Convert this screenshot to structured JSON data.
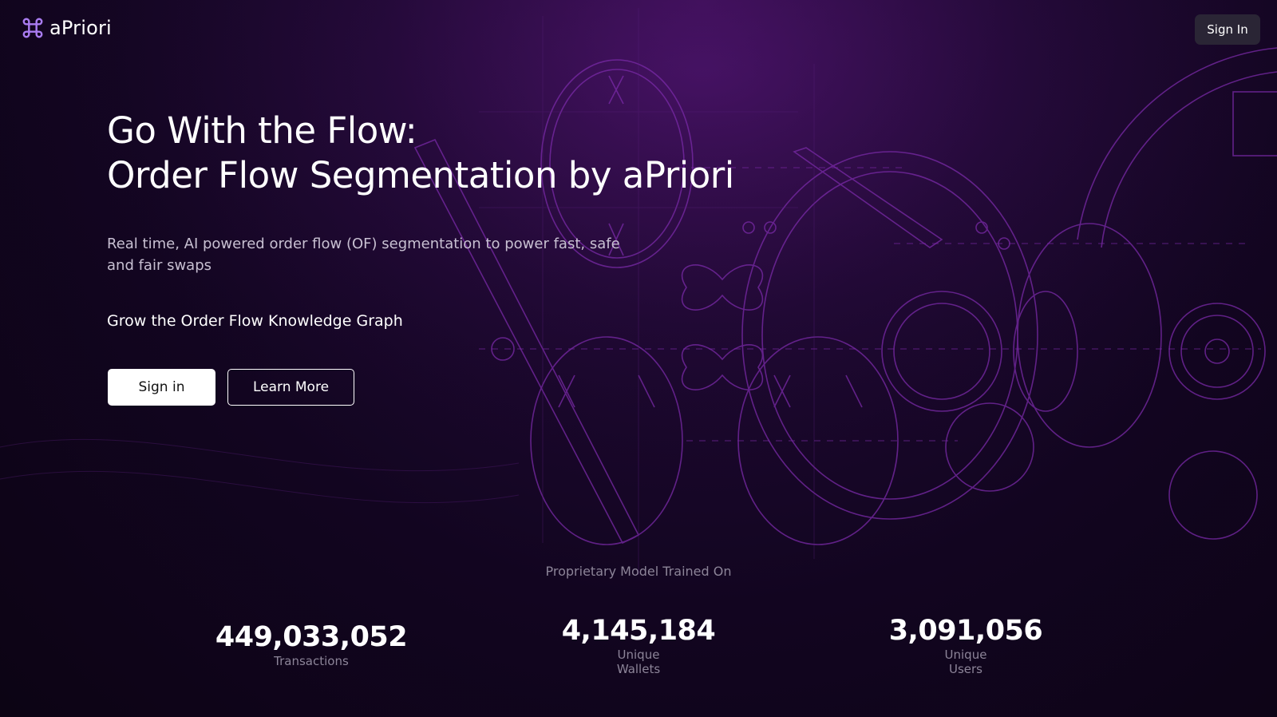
{
  "nav": {
    "brand": "aPriori",
    "signin_label": "Sign In"
  },
  "hero": {
    "title_line1": "Go With the Flow:",
    "title_line2": "Order Flow Segmentation by aPriori",
    "subtitle": "Real time, AI powered order flow (OF) segmentation to power fast, safe and fair swaps",
    "grow": "Grow the Order Flow Knowledge Graph",
    "primary_button": "Sign in",
    "secondary_button": "Learn More"
  },
  "stats": {
    "caption": "Proprietary Model Trained On",
    "items": [
      {
        "value": "449,033,052",
        "label": "Transactions"
      },
      {
        "value": "4,145,184",
        "label": "Unique Wallets"
      },
      {
        "value": "3,091,056",
        "label": "Unique Users"
      }
    ]
  },
  "colors": {
    "accent": "#7b2fc9",
    "logo": "#a97cf0",
    "background": "#120520",
    "nav_button": "#2a2535"
  },
  "icons": {
    "logo": "command-key-icon"
  }
}
